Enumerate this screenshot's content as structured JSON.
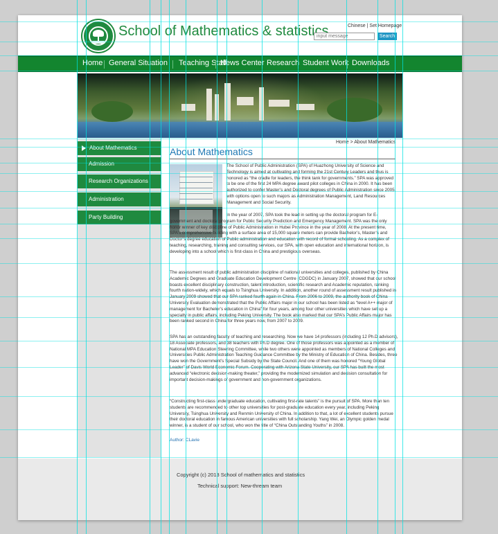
{
  "header": {
    "site_title": "School of Mathematics & statistics",
    "links": [
      "Chinese",
      "Set Homepage"
    ],
    "link_separator": "|",
    "search_placeholder": "input message",
    "search_button": "Search"
  },
  "nav": {
    "items": [
      "Home",
      "General Situation",
      "Teaching Staff",
      "News Center",
      "Research",
      "Student Work",
      "Downloads"
    ]
  },
  "breadcrumb": "Home > About Mathematics",
  "sidebar": {
    "items": [
      "About Mathematics",
      "Admission",
      "Research Organizations",
      "Administration",
      "Party Building"
    ],
    "active_index": 0
  },
  "content": {
    "title": "About Mathematics",
    "paragraphs": [
      "The School of Public Administration (SPA) of Huazhong University of Science and Technology is aimed at cultivating and forming the 21st Century Leaders and thus is honored as “the cradle for leaders, the think tank for governments.” SPA was approved to be one of the first 24 MPA degree award pilot colleges in China in 2000. It has been authorized to confer Master’s and Doctoral degrees of Public Administration since 2005, with options open to such majors as Administration Management, Land Resources Management and Social Security.",
      "In the year of 2007, SPA took the lead in setting up the doctoral program for E-government and doctoral program for Public Security Prediction and Emergency Management. SPA was the only honor winner of key discipline of Public Administration in Hubei Province in the year of 2008. At the present time, SPA’s comprehensive building with a surface area of 15,000 square meters can provide Bachelor’s, Master’s and Doctor’s degree education of Public administration and education with record of formal schooling. As a complex of teaching, researching, training and consulting services, our SPA, with open education and international horizon, is developing into a school which is first-class in China and prestigious overseas.",
      "The assessment result of public administration discipline of national universities and colleges, published by China Academic Degrees and Graduate Education Development Centre (CDGDC) in January 2007, showed that our school boasts excellent disciplinary construction, talent introduction, scientific research and Academic reputation, ranking fourth nation-widely, which equals to Tsinghua University. In addition, another round of assessment result published in January 2009 showed that our SPA ranked fourth again in China. From 2006 to 2009, the authority book of China University Evaluation demonstrated that the Public Affairs major in our school has been listed as “level A++ major of management for Bachelor’s education in China” for four years, among four other universities which have set up a specialty in public affairs, including Peking University. The book also marked that our SPA’s Public Affairs major has been ranked second in China for three years now, from 2007 to 2009.",
      "SPA has an outstanding faculty of teaching and researching. Now we have 14 professors (including 12 Ph.D advisors), 18 Associate professors, and 38 teachers with Ph.D degree. One of those professors was appointed as a member of National MPA Education Steering Committee, while two others were appointed as members of National Colleges and Universities Public Administration Teaching Guidance Committee by the Ministry of Education of China. Besides, three have won the Government’s Special Subsidy by the State Council. And one of them was honored “Young Global Leader” of Davis World Economic Forum. Cooperating with Arizona State University, our SPA has built the most advanced “electronic decision-making theater,” providing the modernized simulation and decision consultation for important decision-makings of government and non-government organizations.",
      "“Constructing first-class undergraduate education, cultivating first-rate talents” is the pursuit of SPA. More than ten students are recommended to other top universities for post-graduate education every year, including Peking University, Tsinghua University and Renmin University of China. In addition to that, a lot of excellent students pursue their doctoral education in famous American universities with full scholarship. Yang Wei, an Olympic golden medal winner, is a student of our school, who won the title of “China Outstanding Youths” in 2008."
    ],
    "author": "Author: CLavie"
  },
  "footer": {
    "copyright": "Copyright (c) 2013  School of mathematics and statistics",
    "support": "Technical support: New-thream team"
  },
  "colors": {
    "brand_green": "#1f8a3f",
    "nav_green": "#13852f",
    "title_blue": "#1f78b4",
    "search_blue": "#2196c4",
    "guide_cyan": "#00e1e1"
  }
}
